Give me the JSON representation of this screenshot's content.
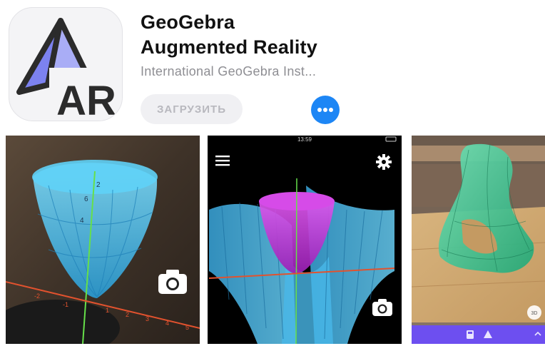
{
  "app": {
    "title_line1": "GeoGebra",
    "title_line2": "Augmented Reality",
    "developer": "International GeoGebra Inst...",
    "get_label": "ЗАГРУЗИТЬ",
    "icon_text": "AR"
  },
  "icons": {
    "more": "more-ellipsis-icon",
    "camera": "camera-icon",
    "menu": "hamburger-menu-icon",
    "settings": "gear-icon"
  },
  "screenshots": [
    {
      "axis_labels": [
        "6",
        "4",
        "2",
        "-1",
        "-2",
        "1",
        "2",
        "3",
        "4",
        "5"
      ]
    },
    {
      "status_time": "13:59"
    },
    {
      "badge": "3D"
    }
  ],
  "colors": {
    "accent_blue": "#1d86f5",
    "surface_cyan": "#4ec6ef",
    "surface_magenta": "#c933e0",
    "surface_green": "#3fcb94",
    "toolbar_purple": "#6d4ff0"
  }
}
